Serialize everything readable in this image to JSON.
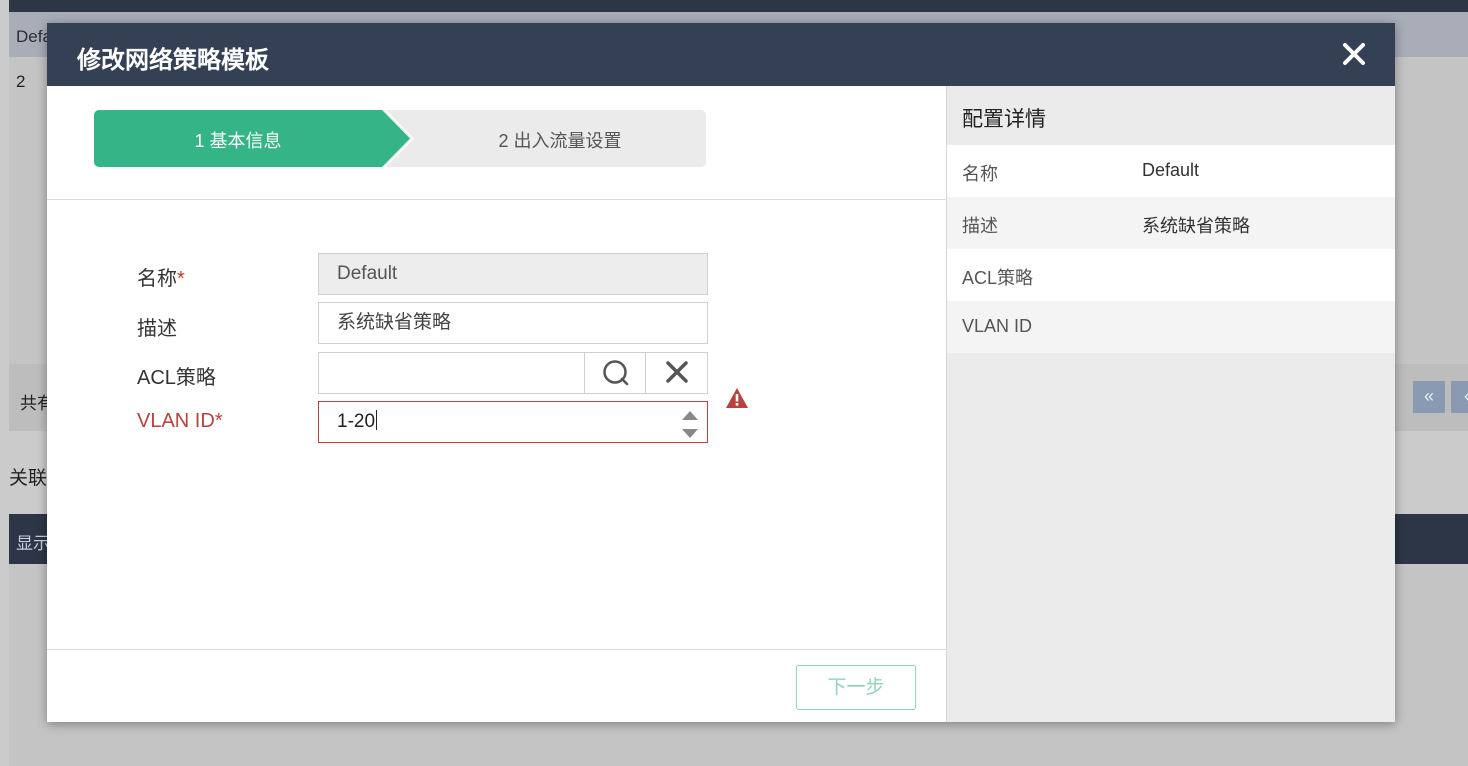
{
  "background": {
    "header_cell": "Defa",
    "row_cell": "2",
    "pager_total": "共有",
    "pager_buttons": [
      "«",
      "‹"
    ],
    "assoc_label": "关联",
    "bar_label": "显示"
  },
  "modal": {
    "title": "修改网络策略模板",
    "close_icon": "close-icon",
    "steps": [
      {
        "label": "1 基本信息",
        "active": true
      },
      {
        "label": "2 出入流量设置",
        "active": false
      }
    ],
    "form": {
      "name_label": "名称",
      "name_value": "Default",
      "desc_label": "描述",
      "desc_value": "系统缺省策略",
      "acl_label": "ACL策略",
      "acl_value": "",
      "vlan_label": "VLAN ID",
      "vlan_value": "1-20",
      "required_mark": "*"
    },
    "next_button": "下一步",
    "details": {
      "title": "配置详情",
      "rows": [
        {
          "key": "名称",
          "value": "Default"
        },
        {
          "key": "描述",
          "value": "系统缺省策略"
        },
        {
          "key": "ACL策略",
          "value": ""
        },
        {
          "key": "VLAN ID",
          "value": ""
        }
      ]
    },
    "colors": {
      "header": "#344154",
      "step_active": "#35b587",
      "error": "#b7423f"
    }
  }
}
